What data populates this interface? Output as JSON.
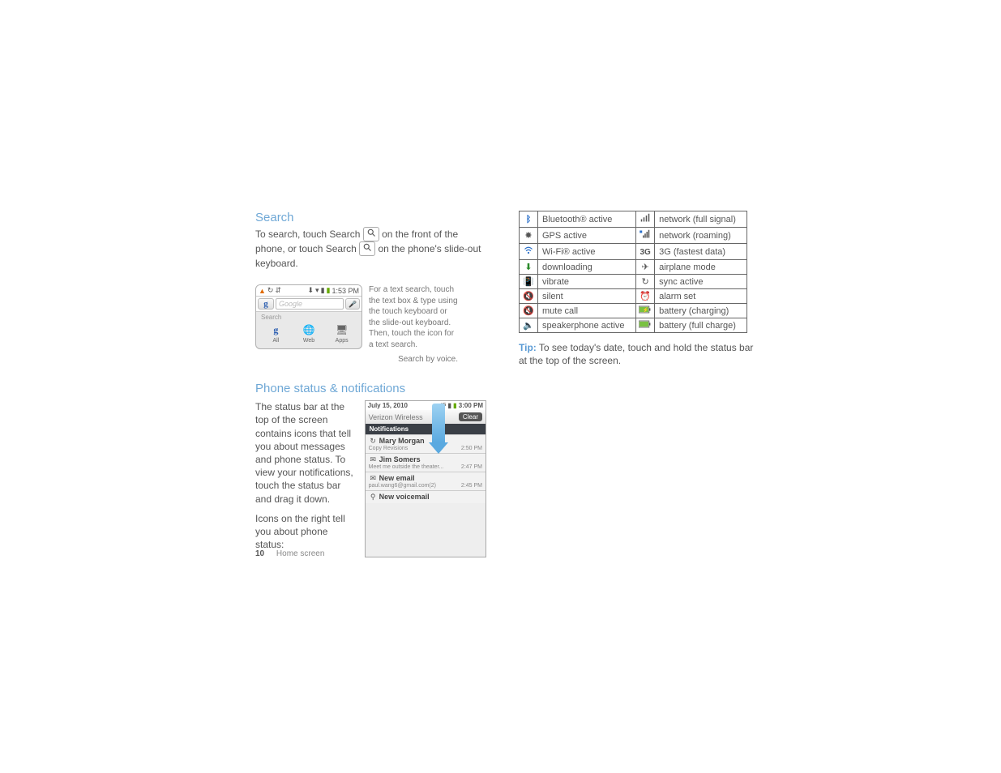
{
  "left": {
    "search_heading": "Search",
    "search_para_a": "To search, touch Search ",
    "search_para_b": " on the front of the phone, or touch Search ",
    "search_para_c": " on the phone's slide-out keyboard.",
    "search_widget": {
      "time": "1:53 PM",
      "placeholder": "Google",
      "panel_label": "Search",
      "tabs": {
        "all": "All",
        "web": "Web",
        "apps": "Apps"
      }
    },
    "side_note": "For a text search, touch the text box & type using the touch keyboard or the slide-out keyboard. Then, touch the icon for a text search.",
    "voice_caption": "Search by voice.",
    "notif_heading": "Phone status & notifications",
    "notif_para1": "The status bar at the top of the screen contains icons that tell you about messages and phone status. To view your notifications, touch the status bar and drag it down.",
    "notif_para2": "Icons on the right tell you about phone status:",
    "notif_widget": {
      "date": "July 15, 2010",
      "time": "3:00 PM",
      "carrier": "Verizon Wireless",
      "clear": "Clear",
      "header": "Notifications",
      "items": [
        {
          "icon": "↻",
          "title": "Mary Morgan",
          "sub": "Copy Revisions",
          "time": "2:50 PM"
        },
        {
          "icon": "✉",
          "title": "Jim Somers",
          "sub": "Meet me outside the theater...",
          "time": "2:47 PM"
        },
        {
          "icon": "✉",
          "title": "New email",
          "sub": "paul.wang6@gmail.com(2)",
          "time": "2:45 PM"
        },
        {
          "icon": "⚲",
          "title": "New voicemail",
          "sub": "",
          "time": ""
        }
      ]
    }
  },
  "right": {
    "rows": [
      {
        "iconL": "bt",
        "labelL": "Bluetooth® active",
        "iconR": "sig",
        "labelR": "network (full signal)"
      },
      {
        "iconL": "gps",
        "labelL": "GPS active",
        "iconR": "roam",
        "labelR": "network (roaming)"
      },
      {
        "iconL": "wifi",
        "labelL": "Wi-Fi® active",
        "iconR": "3g",
        "labelR": "3G (fastest data)"
      },
      {
        "iconL": "dl",
        "labelL": "downloading",
        "iconR": "plane",
        "labelR": "airplane mode"
      },
      {
        "iconL": "vib",
        "labelL": "vibrate",
        "iconR": "sync",
        "labelR": "sync active"
      },
      {
        "iconL": "sil",
        "labelL": "silent",
        "iconR": "alarm",
        "labelR": "alarm set"
      },
      {
        "iconL": "mute",
        "labelL": "mute call",
        "iconR": "chg",
        "labelR": "battery (charging)"
      },
      {
        "iconL": "spk",
        "labelL": "speakerphone active",
        "iconR": "full",
        "labelR": "battery (full charge)"
      }
    ],
    "tip_label": "Tip:",
    "tip_text": " To see today's date, touch and hold the status bar at the top of the screen."
  },
  "footer": {
    "page": "10",
    "title": "Home screen"
  }
}
